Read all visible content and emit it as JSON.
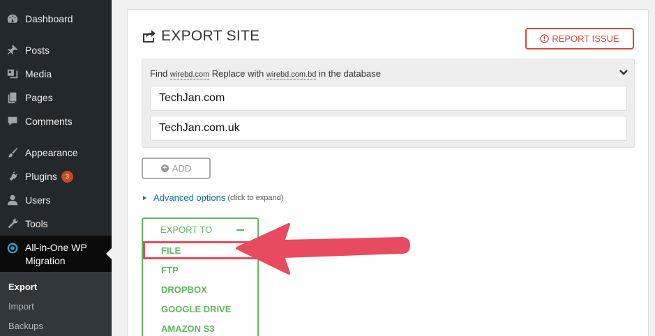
{
  "sidebar": {
    "items": [
      {
        "label": "Dashboard",
        "icon": "dashboard-icon"
      },
      {
        "label": "Posts",
        "icon": "pin-icon"
      },
      {
        "label": "Media",
        "icon": "media-icon"
      },
      {
        "label": "Pages",
        "icon": "pages-icon"
      },
      {
        "label": "Comments",
        "icon": "comment-icon"
      },
      {
        "label": "Appearance",
        "icon": "brush-icon"
      },
      {
        "label": "Plugins",
        "icon": "plug-icon",
        "badge": "3"
      },
      {
        "label": "Users",
        "icon": "user-icon"
      },
      {
        "label": "Tools",
        "icon": "wrench-icon"
      }
    ],
    "active": {
      "label_line1": "All-in-One WP",
      "label_line2": "Migration"
    },
    "submenu": [
      "Export",
      "Import",
      "Backups"
    ]
  },
  "main": {
    "title": "EXPORT SITE",
    "report_label": "REPORT ISSUE",
    "find_word": "Find",
    "find_value": "wirebd.com",
    "replace_word": "Replace with",
    "replace_value": "wirebd.com.bd",
    "tail": "in the database",
    "field1": "TechJan.com",
    "field2": "TechJan.com.uk",
    "add_label": "ADD",
    "advanced_label": "Advanced options",
    "advanced_hint": "(click to expand)",
    "export_to": "EXPORT TO",
    "export_options": [
      "FILE",
      "FTP",
      "DROPBOX",
      "GOOGLE DRIVE",
      "AMAZON S3"
    ]
  },
  "colors": {
    "green": "#5cb85c",
    "red": "#cd4b40",
    "sidebar": "#23282d"
  }
}
